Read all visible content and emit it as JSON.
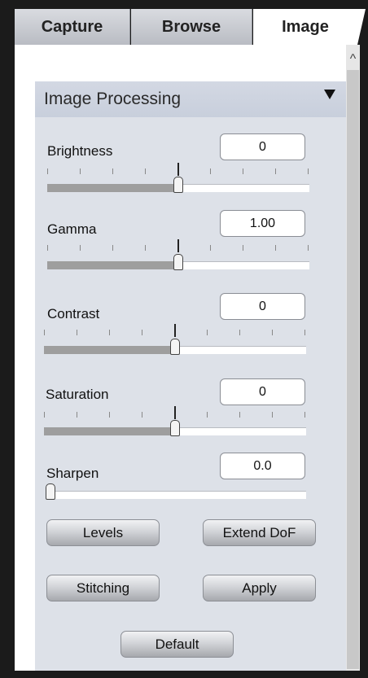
{
  "tabs": [
    {
      "label": "Capture"
    },
    {
      "label": "Browse"
    },
    {
      "label": "Image",
      "active": true
    }
  ],
  "scrollbar": {
    "up_icon": "chevron-up-icon",
    "up_glyph": "^"
  },
  "panel": {
    "title": "Image Processing",
    "collapse_icon": "triangle-down-icon"
  },
  "sliders": {
    "brightness": {
      "label": "Brightness",
      "value": "0",
      "level": 0.5
    },
    "gamma": {
      "label": "Gamma",
      "value": "1.00",
      "level": 0.5
    },
    "contrast": {
      "label": "Contrast",
      "value": "0",
      "level": 0.5
    },
    "saturation": {
      "label": "Saturation",
      "value": "0",
      "level": 0.5
    },
    "sharpen": {
      "label": "Sharpen",
      "value": "0.0",
      "level": 0.0
    }
  },
  "buttons": {
    "levels": "Levels",
    "extend_dof": "Extend DoF",
    "stitching": "Stitching",
    "apply": "Apply",
    "default": "Default"
  },
  "colors": {
    "panel_bg": "#dde1e8",
    "header_bg": "#c8cfdc",
    "slider_fill": "#9e9e9e",
    "frame": "#1b1b1b"
  }
}
